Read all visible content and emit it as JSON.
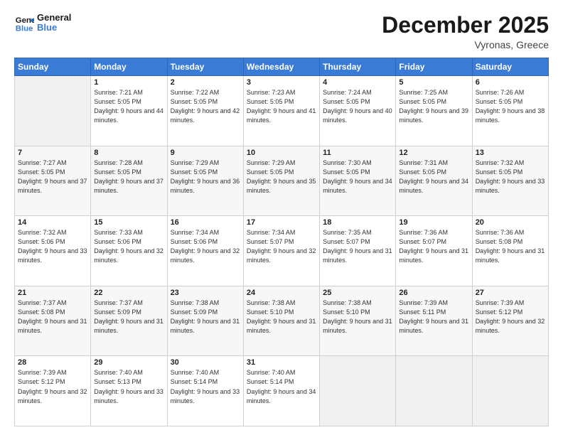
{
  "header": {
    "logo_line1": "General",
    "logo_line2": "Blue",
    "month_title": "December 2025",
    "location": "Vyronas, Greece"
  },
  "weekdays": [
    "Sunday",
    "Monday",
    "Tuesday",
    "Wednesday",
    "Thursday",
    "Friday",
    "Saturday"
  ],
  "weeks": [
    [
      {
        "day": "",
        "sunrise": "",
        "sunset": "",
        "daylight": ""
      },
      {
        "day": "1",
        "sunrise": "7:21 AM",
        "sunset": "5:05 PM",
        "daylight": "9 hours and 44 minutes."
      },
      {
        "day": "2",
        "sunrise": "7:22 AM",
        "sunset": "5:05 PM",
        "daylight": "9 hours and 42 minutes."
      },
      {
        "day": "3",
        "sunrise": "7:23 AM",
        "sunset": "5:05 PM",
        "daylight": "9 hours and 41 minutes."
      },
      {
        "day": "4",
        "sunrise": "7:24 AM",
        "sunset": "5:05 PM",
        "daylight": "9 hours and 40 minutes."
      },
      {
        "day": "5",
        "sunrise": "7:25 AM",
        "sunset": "5:05 PM",
        "daylight": "9 hours and 39 minutes."
      },
      {
        "day": "6",
        "sunrise": "7:26 AM",
        "sunset": "5:05 PM",
        "daylight": "9 hours and 38 minutes."
      }
    ],
    [
      {
        "day": "7",
        "sunrise": "7:27 AM",
        "sunset": "5:05 PM",
        "daylight": "9 hours and 37 minutes."
      },
      {
        "day": "8",
        "sunrise": "7:28 AM",
        "sunset": "5:05 PM",
        "daylight": "9 hours and 37 minutes."
      },
      {
        "day": "9",
        "sunrise": "7:29 AM",
        "sunset": "5:05 PM",
        "daylight": "9 hours and 36 minutes."
      },
      {
        "day": "10",
        "sunrise": "7:29 AM",
        "sunset": "5:05 PM",
        "daylight": "9 hours and 35 minutes."
      },
      {
        "day": "11",
        "sunrise": "7:30 AM",
        "sunset": "5:05 PM",
        "daylight": "9 hours and 34 minutes."
      },
      {
        "day": "12",
        "sunrise": "7:31 AM",
        "sunset": "5:05 PM",
        "daylight": "9 hours and 34 minutes."
      },
      {
        "day": "13",
        "sunrise": "7:32 AM",
        "sunset": "5:05 PM",
        "daylight": "9 hours and 33 minutes."
      }
    ],
    [
      {
        "day": "14",
        "sunrise": "7:32 AM",
        "sunset": "5:06 PM",
        "daylight": "9 hours and 33 minutes."
      },
      {
        "day": "15",
        "sunrise": "7:33 AM",
        "sunset": "5:06 PM",
        "daylight": "9 hours and 32 minutes."
      },
      {
        "day": "16",
        "sunrise": "7:34 AM",
        "sunset": "5:06 PM",
        "daylight": "9 hours and 32 minutes."
      },
      {
        "day": "17",
        "sunrise": "7:34 AM",
        "sunset": "5:07 PM",
        "daylight": "9 hours and 32 minutes."
      },
      {
        "day": "18",
        "sunrise": "7:35 AM",
        "sunset": "5:07 PM",
        "daylight": "9 hours and 31 minutes."
      },
      {
        "day": "19",
        "sunrise": "7:36 AM",
        "sunset": "5:07 PM",
        "daylight": "9 hours and 31 minutes."
      },
      {
        "day": "20",
        "sunrise": "7:36 AM",
        "sunset": "5:08 PM",
        "daylight": "9 hours and 31 minutes."
      }
    ],
    [
      {
        "day": "21",
        "sunrise": "7:37 AM",
        "sunset": "5:08 PM",
        "daylight": "9 hours and 31 minutes."
      },
      {
        "day": "22",
        "sunrise": "7:37 AM",
        "sunset": "5:09 PM",
        "daylight": "9 hours and 31 minutes."
      },
      {
        "day": "23",
        "sunrise": "7:38 AM",
        "sunset": "5:09 PM",
        "daylight": "9 hours and 31 minutes."
      },
      {
        "day": "24",
        "sunrise": "7:38 AM",
        "sunset": "5:10 PM",
        "daylight": "9 hours and 31 minutes."
      },
      {
        "day": "25",
        "sunrise": "7:38 AM",
        "sunset": "5:10 PM",
        "daylight": "9 hours and 31 minutes."
      },
      {
        "day": "26",
        "sunrise": "7:39 AM",
        "sunset": "5:11 PM",
        "daylight": "9 hours and 31 minutes."
      },
      {
        "day": "27",
        "sunrise": "7:39 AM",
        "sunset": "5:12 PM",
        "daylight": "9 hours and 32 minutes."
      }
    ],
    [
      {
        "day": "28",
        "sunrise": "7:39 AM",
        "sunset": "5:12 PM",
        "daylight": "9 hours and 32 minutes."
      },
      {
        "day": "29",
        "sunrise": "7:40 AM",
        "sunset": "5:13 PM",
        "daylight": "9 hours and 33 minutes."
      },
      {
        "day": "30",
        "sunrise": "7:40 AM",
        "sunset": "5:14 PM",
        "daylight": "9 hours and 33 minutes."
      },
      {
        "day": "31",
        "sunrise": "7:40 AM",
        "sunset": "5:14 PM",
        "daylight": "9 hours and 34 minutes."
      },
      {
        "day": "",
        "sunrise": "",
        "sunset": "",
        "daylight": ""
      },
      {
        "day": "",
        "sunrise": "",
        "sunset": "",
        "daylight": ""
      },
      {
        "day": "",
        "sunrise": "",
        "sunset": "",
        "daylight": ""
      }
    ]
  ]
}
